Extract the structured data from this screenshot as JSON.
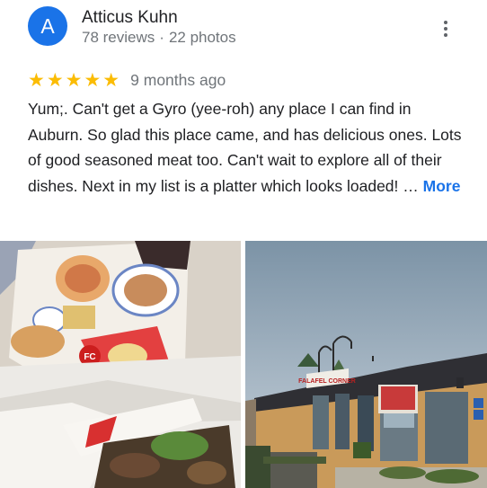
{
  "reviewer": {
    "avatar_letter": "A",
    "avatar_color": "#1a73e8",
    "name": "Atticus Kuhn",
    "reviews_count": "78 reviews",
    "separator": "·",
    "photos_count": "22 photos"
  },
  "review": {
    "stars_glyphs": "★★★★★",
    "rating": 5,
    "time_ago": "9 months ago",
    "text": "Yum;. Can't get a Gyro (yee-roh) any place I can find in Auburn. So glad this place came, and has delicious ones. Lots of good seasoned meat too. Can't wait to explore all of their dishes. Next in my list is a platter which looks loaded! … ",
    "more_label": "More"
  },
  "photos": [
    {
      "subject": "gyro in takeout container with menu",
      "badge_text": "FC"
    },
    {
      "subject": "restaurant storefront",
      "sign_text": "FALAFEL CORNER"
    }
  ],
  "colors": {
    "star": "#fbbc04",
    "link": "#1a73e8",
    "secondary_text": "#70757a"
  }
}
